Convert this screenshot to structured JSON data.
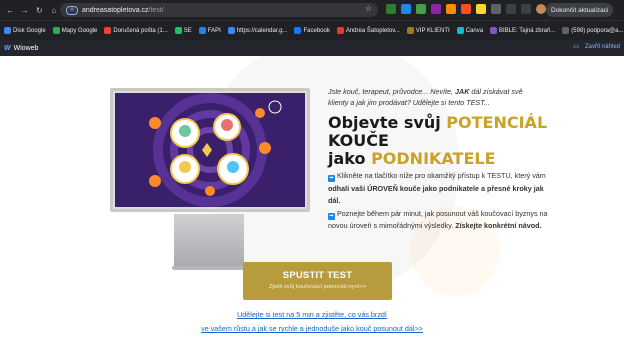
{
  "browser": {
    "url_host": "andreasatopletova.cz",
    "url_path": "/test/",
    "update_button": "Dokončit aktualizaci",
    "bookmarks": [
      {
        "label": "Disk Google",
        "color": "#4285f4"
      },
      {
        "label": "Mapy Google",
        "color": "#34a853"
      },
      {
        "label": "Doručená pošta (1...",
        "color": "#ea4335"
      },
      {
        "label": "SE",
        "color": "#1fbf6b"
      },
      {
        "label": "FAPI",
        "color": "#1e88e5"
      },
      {
        "label": "https://calendar.g...",
        "color": "#4285f4"
      },
      {
        "label": "Facebook",
        "color": "#1877f2"
      },
      {
        "label": "Andrea Šatopletov...",
        "color": "#e53935"
      },
      {
        "label": "VIP KLIENTI",
        "color": "#9c7b1e"
      },
      {
        "label": "Canva",
        "color": "#00c4cc"
      },
      {
        "label": "BIBLE: Tajná zbraň...",
        "color": "#7e57c2"
      },
      {
        "label": "(598) podpora@a...",
        "color": "#5f6368"
      }
    ]
  },
  "wioweb": {
    "logo": "Wioweb",
    "close_preview": "Zavřít náhled"
  },
  "hero": {
    "intro_part1": "Jste kouč, terapeut, průvodce... Nevíte, ",
    "intro_bold": "JAK",
    "intro_part2": " dál získávat svě klienty a jak jim prodávat? Udělejte si tento TEST...",
    "headline_line1_a": "Objevte svůj ",
    "headline_line1_gold": "POTENCIÁL",
    "headline_line1_b": " KOUČE",
    "headline_line2_a": "jako ",
    "headline_line2_gold": "PODNIKATELE",
    "p1_a": "Klikněte na tlačítko níže pro okamžitý přístup k TESTU, který vám ",
    "p1_bold": "odhalí vaši ÚROVEŇ kouče jako podnikatele a přesné kroky jak dál.",
    "p2_a": "Poznejte během pár minut, jak posunout váš koučovací byznys na novou úroveň s mimořádnými výsledky. ",
    "p2_bold": "Získejte konkrétní návod."
  },
  "cta": {
    "title": "SPUSTIT TEST",
    "subtitle": "Zjistit svůj koučovací potenciál nyní>>"
  },
  "links": {
    "line1": "Udělejte si test na 5 min a zjistěte, co vás brzdí",
    "line2": "ve vašem růstu a jak se rychle a jednoduše jako kouč posunout dál>>"
  }
}
